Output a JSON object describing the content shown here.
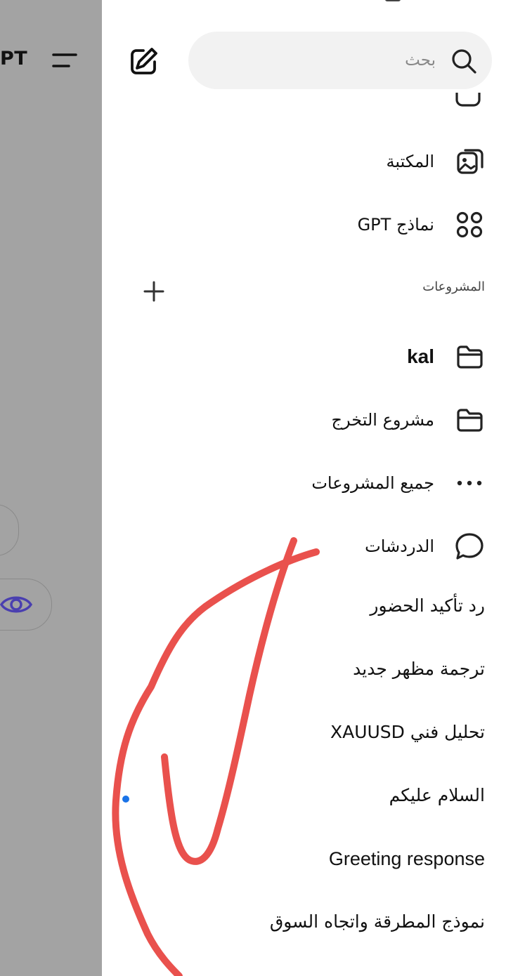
{
  "background": {
    "app_title_fragment": "PT"
  },
  "search": {
    "placeholder": "بحث"
  },
  "nav": {
    "library_label": "المكتبة",
    "gpts_label": "نماذج GPT"
  },
  "projects": {
    "section_title": "المشروعات",
    "items": [
      {
        "label": "kal",
        "icon": "folder-icon"
      },
      {
        "label": "مشروع التخرج",
        "icon": "folder-icon"
      }
    ],
    "all_projects_label": "جميع المشروعات"
  },
  "chats": {
    "section_label": "الدردشات",
    "items": [
      {
        "label": "رد تأكيد الحضور"
      },
      {
        "label": "ترجمة مظهر جديد"
      },
      {
        "label": "تحليل فني XAUUSD"
      },
      {
        "label": "السلام عليكم",
        "unread": true
      },
      {
        "label": "Greeting response"
      },
      {
        "label": "نموذج المطرقة واتجاه السوق"
      }
    ]
  },
  "colors": {
    "overlay": "#a3a3a3",
    "search_bg": "#f2f2f2",
    "annotation_stroke": "#e9514d",
    "unread_dot": "#1a73e8"
  }
}
